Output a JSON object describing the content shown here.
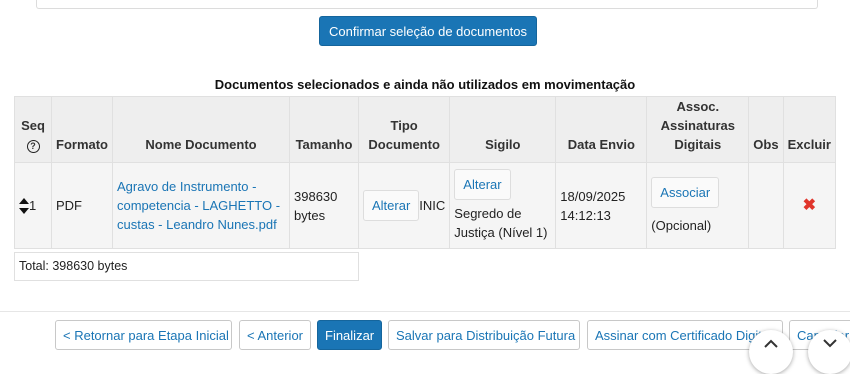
{
  "confirm_button": "Confirmar seleção de documentos",
  "table": {
    "title": "Documentos selecionados e ainda não utilizados em movimentação",
    "headers": {
      "seq": "Seq",
      "formato": "Formato",
      "nome": "Nome Documento",
      "tamanho": "Tamanho",
      "tipo_line1": "Tipo",
      "tipo_line2": "Documento",
      "sigilo": "Sigilo",
      "data": "Data Envio",
      "assoc_line1": "Assoc.",
      "assoc_line2": "Assinaturas",
      "assoc_line3": "Digitais",
      "obs": "Obs",
      "excluir": "Excluir"
    },
    "row": {
      "seq": "1",
      "formato": "PDF",
      "nome_line1": "Agravo de Instrumento -",
      "nome_line2": "competencia - LAGHETTO -",
      "nome_line3": "custas - Leandro Nunes.pdf",
      "tamanho_line1": "398630",
      "tamanho_line2": "bytes",
      "alterar_tipo": "Alterar",
      "tipo_value": "INIC",
      "alterar_sigilo": "Alterar",
      "sigilo_line1": "Segredo de",
      "sigilo_line2": "Justiça (Nível 1)",
      "data_line1": "18/09/2025",
      "data_line2": "14:12:13",
      "associar": "Associar",
      "assoc_note": "(Opcional)",
      "obs": "",
      "excluir_icon": "delete-x-icon"
    },
    "total": "Total: 398630 bytes"
  },
  "footer": {
    "retornar": "< Retornar para Etapa Inicial",
    "anterior": "< Anterior",
    "finalizar": "Finalizar",
    "salvar": "Salvar para Distribuição Futura",
    "assinar": "Assinar com Certificado Digital",
    "cancelar": "Cancelar"
  },
  "colors": {
    "primary": "#1a75b5",
    "header_bg": "#eeeeee",
    "row_bg": "#f5f5f5",
    "delete": "#e0352b"
  }
}
